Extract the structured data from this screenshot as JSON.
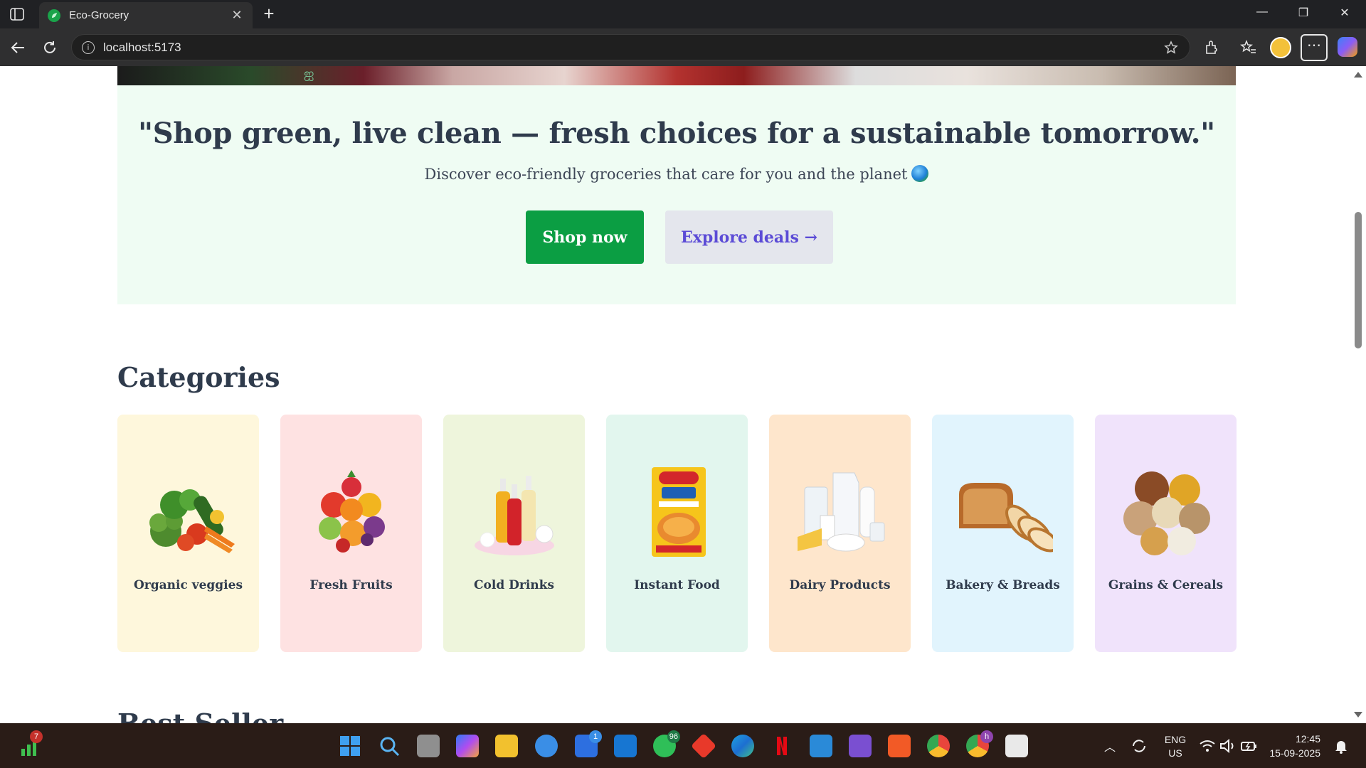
{
  "browser": {
    "tab_title": "Eco-Grocery",
    "tab_close": "✕",
    "new_tab": "+",
    "url": "localhost:5173",
    "more": "⋯",
    "window_controls": {
      "minimize": "—",
      "restore": "❐",
      "close": "✕"
    }
  },
  "hero": {
    "quote": "\"Shop green, live clean — fresh choices for a sustainable tomorrow.\"",
    "subtitle": "Discover eco-friendly groceries that care for you and the planet",
    "shop_now": "Shop now",
    "explore_deals": "Explore deals →"
  },
  "categories": {
    "title": "Categories",
    "items": [
      {
        "label": "Organic veggies",
        "bg": "#fef7dc"
      },
      {
        "label": "Fresh Fruits",
        "bg": "#fee2e2"
      },
      {
        "label": "Cold Drinks",
        "bg": "#eef5dc"
      },
      {
        "label": "Instant Food",
        "bg": "#e2f6ee"
      },
      {
        "label": "Dairy Products",
        "bg": "#fee6cc"
      },
      {
        "label": "Bakery & Breads",
        "bg": "#e1f4fd"
      },
      {
        "label": "Grains & Cereals",
        "bg": "#f0e3fb"
      }
    ]
  },
  "best_seller": {
    "title": "Best Seller"
  },
  "taskbar": {
    "badges": {
      "stocks": "7",
      "teams": "1",
      "whatsapp": "96",
      "chrome_profile": "h"
    },
    "language": "ENG",
    "region": "US",
    "time": "12:45",
    "date": "15-09-2025"
  },
  "colors": {
    "brand_green": "#0b9e43",
    "hero_bg": "#effcf3",
    "heading": "#2f3b4c",
    "explore_text": "#5b4bd6"
  }
}
